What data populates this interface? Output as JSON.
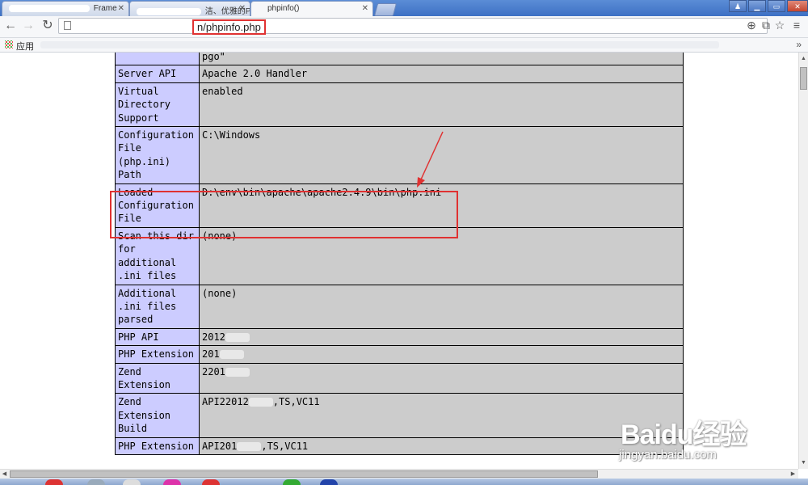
{
  "browser": {
    "tabs": [
      {
        "title": "Frame"
      },
      {
        "title": "洁、优雅的PHP"
      },
      {
        "title": "phpinfo()"
      }
    ],
    "url": "n/phpinfo.php",
    "bookmarks_apps_label": "应用"
  },
  "phpinfo": {
    "rows": [
      {
        "name": "",
        "value": "pgo\""
      },
      {
        "name": "Server API",
        "value": "Apache 2.0 Handler"
      },
      {
        "name": "Virtual Directory Support",
        "value": "enabled"
      },
      {
        "name": "Configuration File (php.ini) Path",
        "value": "C:\\Windows"
      },
      {
        "name": "Loaded Configuration File",
        "value": "D:\\env\\bin\\apache\\apache2.4.9\\bin\\php.ini"
      },
      {
        "name": "Scan this dir for additional .ini files",
        "value": "(none)"
      },
      {
        "name": "Additional .ini files parsed",
        "value": "(none)"
      },
      {
        "name": "PHP API",
        "value": "2012"
      },
      {
        "name": "PHP Extension",
        "value": "201"
      },
      {
        "name": "Zend Extension",
        "value": "2201"
      },
      {
        "name": "Zend Extension Build",
        "value": "API22012",
        "value_suffix": ",TS,VC11"
      },
      {
        "name": "PHP Extension",
        "value": "API201",
        "value_suffix": ",TS,VC11"
      }
    ]
  },
  "watermark": {
    "logo": "Baidu经验",
    "sub": "jingyan.baidu.com"
  },
  "colors": {
    "annotation_red": "#e03232",
    "row_label_bg": "#ccccff",
    "row_value_bg": "#cccccc"
  }
}
